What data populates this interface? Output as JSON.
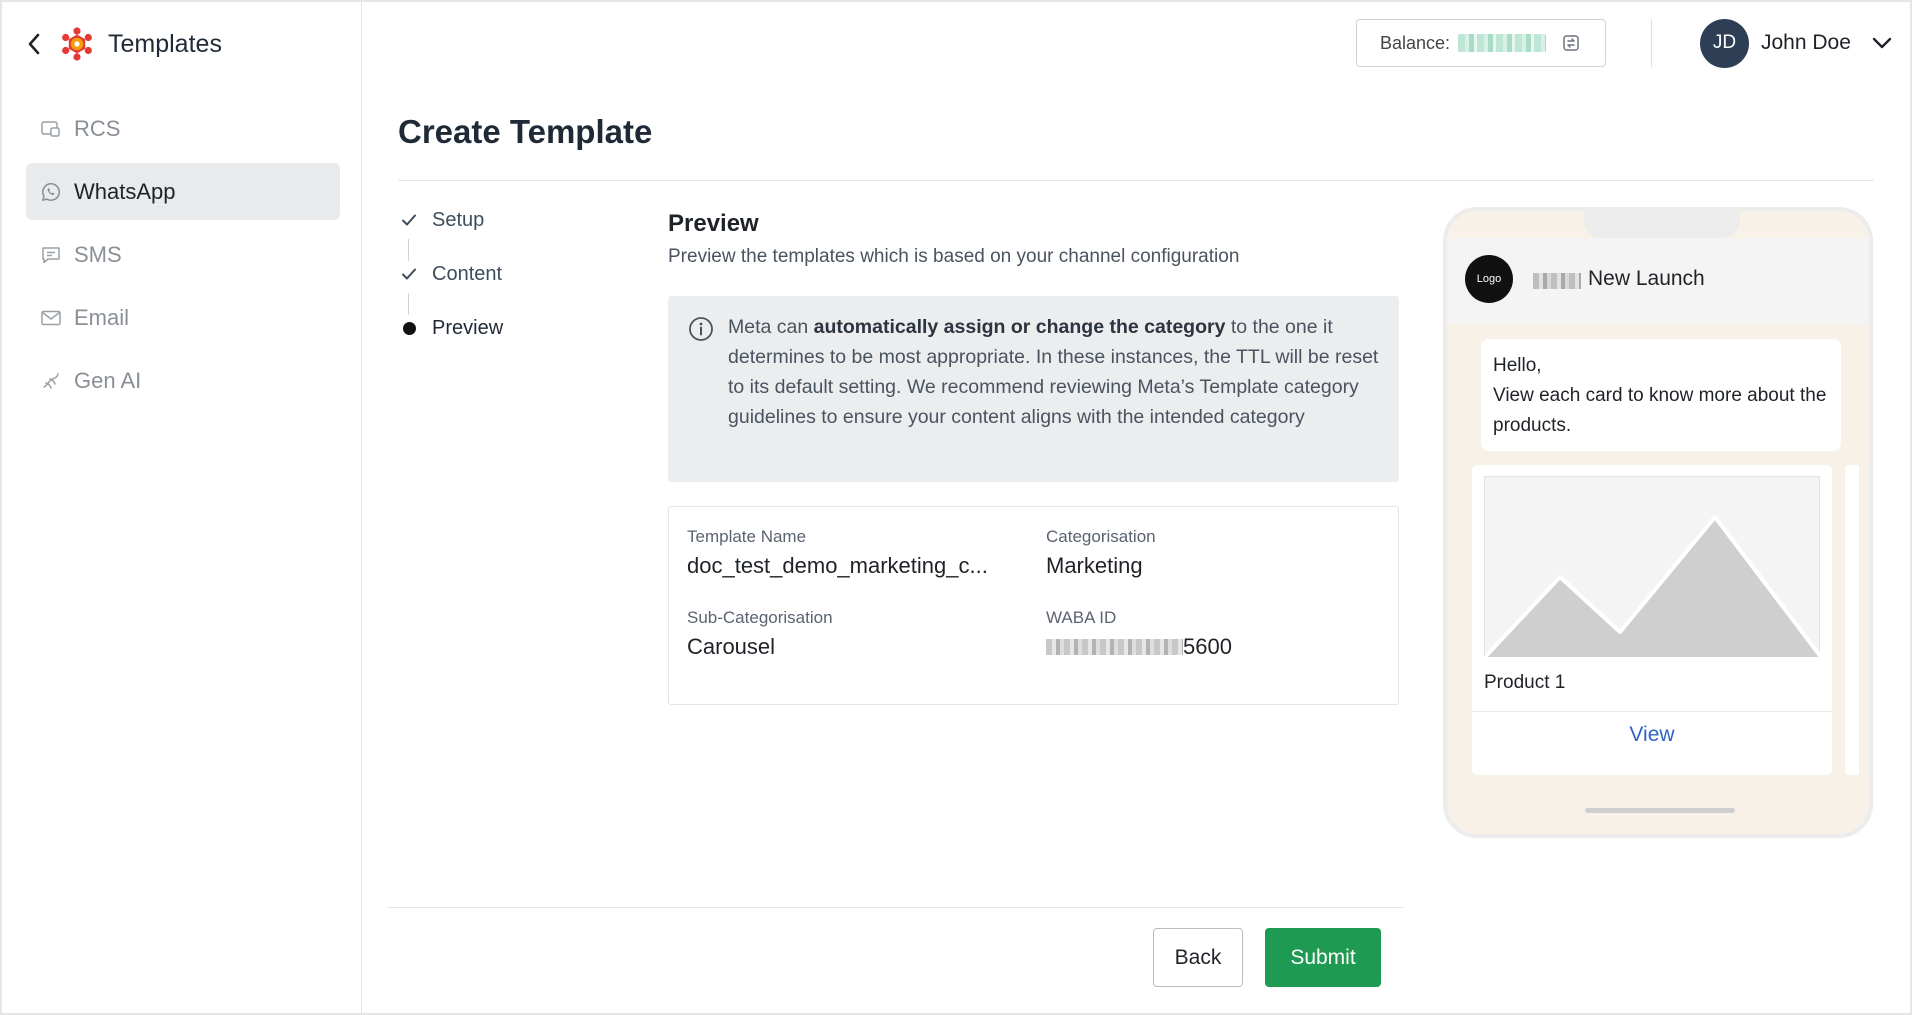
{
  "sidebar": {
    "title": "Templates",
    "items": [
      {
        "label": "RCS",
        "icon": "rcs-icon",
        "active": false
      },
      {
        "label": "WhatsApp",
        "icon": "whatsapp-icon",
        "active": true
      },
      {
        "label": "SMS",
        "icon": "sms-icon",
        "active": false
      },
      {
        "label": "Email",
        "icon": "email-icon",
        "active": false
      },
      {
        "label": "Gen AI",
        "icon": "gen-ai-icon",
        "active": false
      }
    ]
  },
  "topbar": {
    "balance_label": "Balance:",
    "user_initials": "JD",
    "user_name": "John Doe"
  },
  "page": {
    "title": "Create Template"
  },
  "stepper": {
    "steps": [
      {
        "label": "Setup",
        "state": "done"
      },
      {
        "label": "Content",
        "state": "done"
      },
      {
        "label": "Preview",
        "state": "current"
      }
    ]
  },
  "preview": {
    "title": "Preview",
    "subtitle": "Preview the templates which is based on your channel configuration",
    "info": {
      "pre": "Meta can ",
      "bold": "automatically assign or change the category",
      "post": " to the one it determines to be most appropriate. In these instances, the TTL will be reset to its default setting. We recommend reviewing Meta’s Template category guidelines to ensure your content aligns with the intended category"
    },
    "details": {
      "template_name_label": "Template Name",
      "template_name_value": "doc_test_demo_marketing_c...",
      "categorisation_label": "Categorisation",
      "categorisation_value": "Marketing",
      "sub_categorisation_label": "Sub-Categorisation",
      "sub_categorisation_value": "Carousel",
      "waba_id_label": "WABA ID",
      "waba_id_visible_suffix": "5600"
    }
  },
  "actions": {
    "back_label": "Back",
    "submit_label": "Submit"
  },
  "phone": {
    "logo_text": "Logo",
    "business_name_suffix": "New Launch",
    "message_line1": "Hello,",
    "message_line2": "View each card to know more about the products.",
    "card": {
      "title": "Product 1",
      "cta_label": "View"
    }
  },
  "colors": {
    "accent_green": "#1f9a52",
    "brand_red": "#e53935",
    "brand_orange": "#f59e0b",
    "link_blue": "#2f64c7",
    "avatar_bg": "#2d3e55"
  }
}
